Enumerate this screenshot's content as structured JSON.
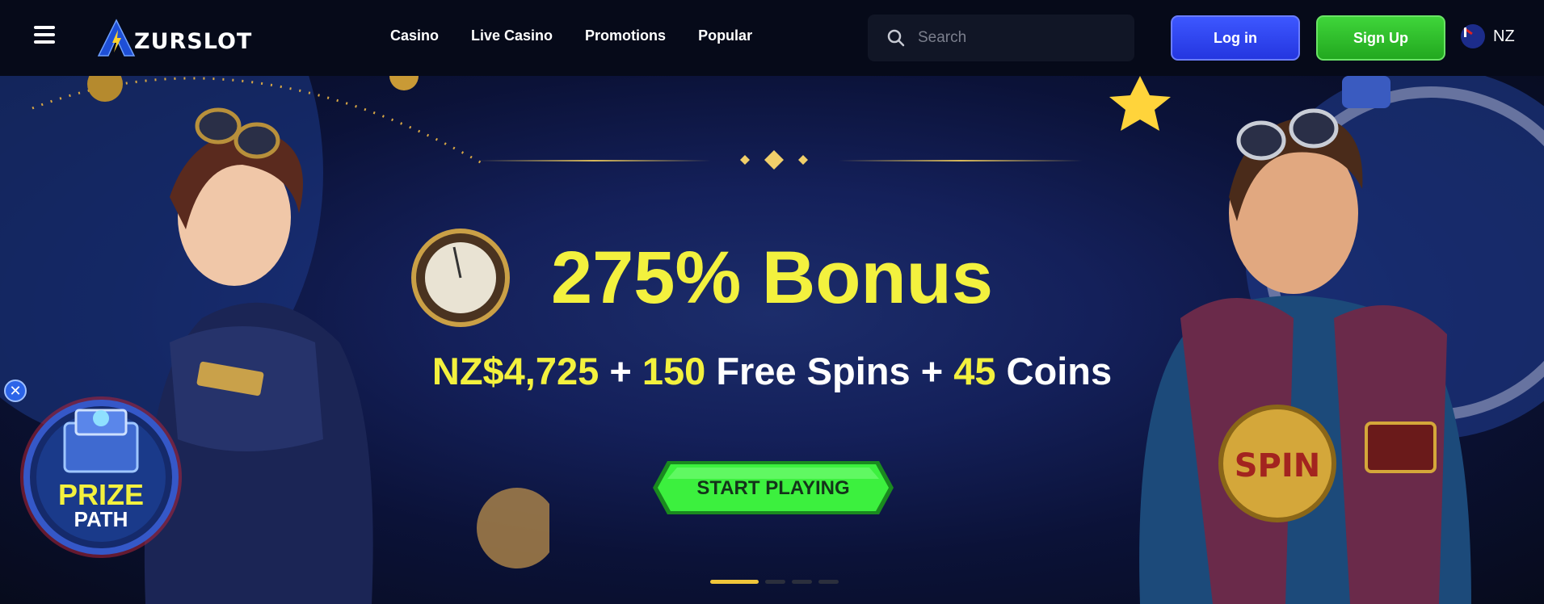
{
  "header": {
    "logo_text": "ZURSLOT",
    "nav": [
      "Casino",
      "Live Casino",
      "Promotions",
      "Popular"
    ],
    "search_placeholder": "Search",
    "login_label": "Log in",
    "signup_label": "Sign Up",
    "language": "NZ"
  },
  "hero": {
    "headline": "275% Bonus",
    "amount": "NZ$4,725",
    "plus1": " + ",
    "spins_count": "150",
    "spins_label": " Free Spins + ",
    "coins_count": "45",
    "coins_label": " Coins",
    "cta_label": "START PLAYING",
    "slide_count": 4,
    "active_slide": 0
  },
  "prize_widget": {
    "line1": "PRIZE",
    "line2": "PATH",
    "close_symbol": "✕"
  },
  "colors": {
    "accent_yellow": "#f3f13e",
    "login_blue": "#2d45f0",
    "signup_green": "#2fbf2a",
    "cta_green": "#35f23a"
  }
}
